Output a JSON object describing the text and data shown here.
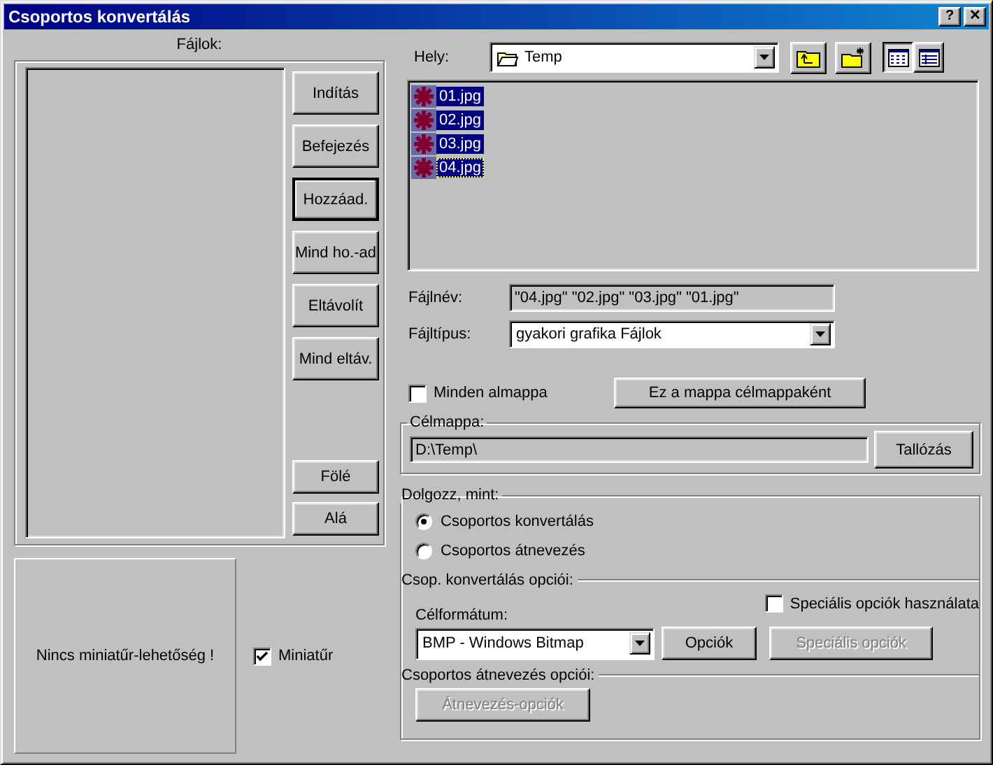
{
  "window": {
    "title": "Csoportos konvertálás",
    "help_button": "?",
    "close_button": "✕"
  },
  "files_panel": {
    "label": "Fájlok:",
    "buttons_top": [
      {
        "label": "Indítás",
        "default": false
      },
      {
        "label": "Befejezés",
        "default": false
      },
      {
        "label": "Hozzáad.",
        "default": true
      },
      {
        "label": "Mind ho.-ad",
        "default": false
      },
      {
        "label": "Eltávolít",
        "default": false
      },
      {
        "label": "Mind eltáv.",
        "default": false
      }
    ],
    "buttons_bottom": [
      {
        "label": "Fölé",
        "default": false
      },
      {
        "label": "Alá",
        "default": false
      }
    ]
  },
  "thumbnail": {
    "message": "Nincs miniatűr-lehetőség !"
  },
  "miniature_checkbox": {
    "label": "Miniatűr",
    "checked": true
  },
  "location": {
    "label": "Hely:",
    "value": "Temp"
  },
  "view_buttons": [
    {
      "kind": "list",
      "selected": true
    },
    {
      "kind": "details",
      "selected": false
    }
  ],
  "files": [
    {
      "name": "01.jpg",
      "selected": true,
      "focused": false
    },
    {
      "name": "02.jpg",
      "selected": true,
      "focused": false
    },
    {
      "name": "03.jpg",
      "selected": true,
      "focused": false
    },
    {
      "name": "04.jpg",
      "selected": true,
      "focused": true
    }
  ],
  "filename": {
    "label": "Fájlnév:",
    "value": "\"04.jpg\" \"02.jpg\" \"03.jpg\" \"01.jpg\""
  },
  "filetype": {
    "label": "Fájltípus:",
    "value": "gyakori grafika Fájlok"
  },
  "all_subfolders": {
    "label": "Minden almappa",
    "checked": false
  },
  "set_target_button": "Ez a mappa célmappaként",
  "target_folder": {
    "label": "Célmappa:",
    "value": "D:\\Temp\\",
    "button": "Tallózás"
  },
  "work_as": {
    "label": "Dolgozz, mint:",
    "options": [
      {
        "label": "Csoportos konvertálás",
        "selected": true
      },
      {
        "label": "Csoportos átnevezés",
        "selected": false
      }
    ]
  },
  "convert_options": {
    "label": "Csop. konvertálás opciói:",
    "format_label": "Célformátum:",
    "format_value": "BMP - Windows Bitmap",
    "options_button": {
      "label": "Opciók",
      "disabled": false
    },
    "special_checkbox": {
      "label": "Speciális opciók használata",
      "checked": false
    },
    "special_button": {
      "label": "Speciális opciók",
      "disabled": true
    }
  },
  "rename_options": {
    "label": "Csoportos átnevezés opciói:",
    "button": {
      "label": "Átnevezés-opciók",
      "disabled": true
    }
  }
}
